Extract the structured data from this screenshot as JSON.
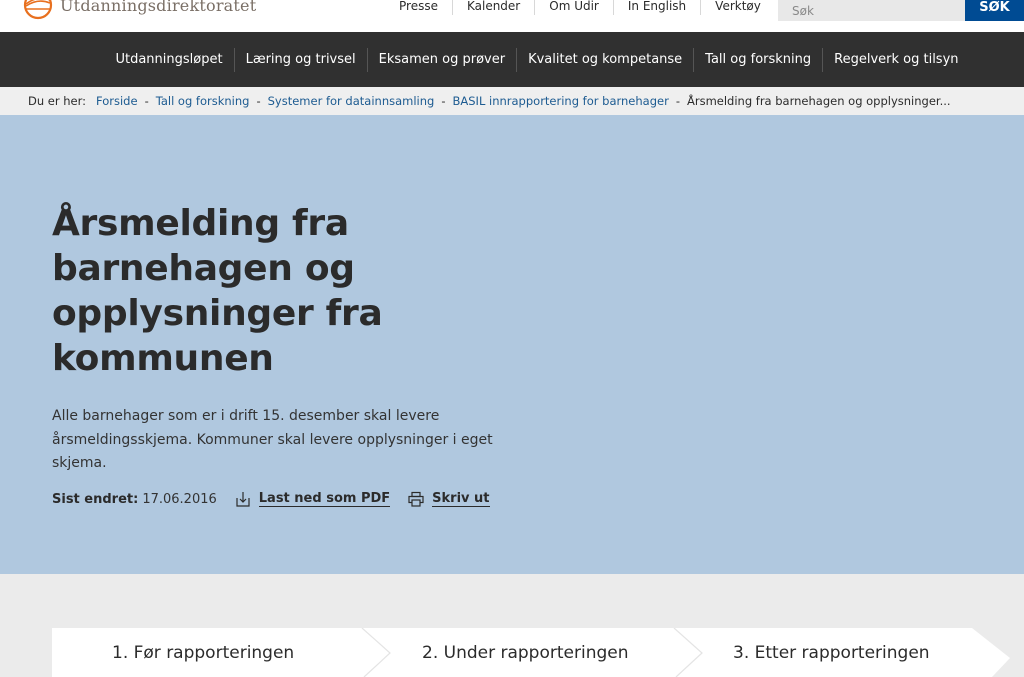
{
  "header": {
    "logo_text": "Utdanningsdirektoratet",
    "brand_color": "#e8701f",
    "utility_links": [
      "Presse",
      "Kalender",
      "Om Udir",
      "In English",
      "Verktøy"
    ],
    "search": {
      "placeholder": "Søk",
      "value": "",
      "button_label": "SØK",
      "button_color": "#004b93"
    }
  },
  "main_nav": {
    "items": [
      "Utdanningsløpet",
      "Læring og trivsel",
      "Eksamen og prøver",
      "Kvalitet og kompetanse",
      "Tall og forskning",
      "Regelverk og tilsyn"
    ]
  },
  "breadcrumb": {
    "label": "Du er her:",
    "links": [
      "Forside",
      "Tall og forskning",
      "Systemer for datainnsamling",
      "BASIL innrapportering for barnehager"
    ],
    "separator": "-",
    "current": "Årsmelding fra barnehagen og opplysninger..."
  },
  "hero": {
    "title": "Årsmelding fra barnehagen og opplysninger fra kommunen",
    "lead": "Alle barnehager som er i drift 15. desember skal levere årsmeldingsskjema. Kommuner skal levere opplysninger i eget skjema.",
    "last_changed_label": "Sist endret:",
    "last_changed_value": "17.06.2016",
    "download_pdf_label": "Last ned som PDF",
    "print_label": "Skriv ut",
    "background_color": "#b0c8df"
  },
  "process_steps": [
    {
      "label": "1. Før rapporteringen"
    },
    {
      "label": "2. Under rapporteringen"
    },
    {
      "label": "3. Etter rapporteringen"
    }
  ]
}
